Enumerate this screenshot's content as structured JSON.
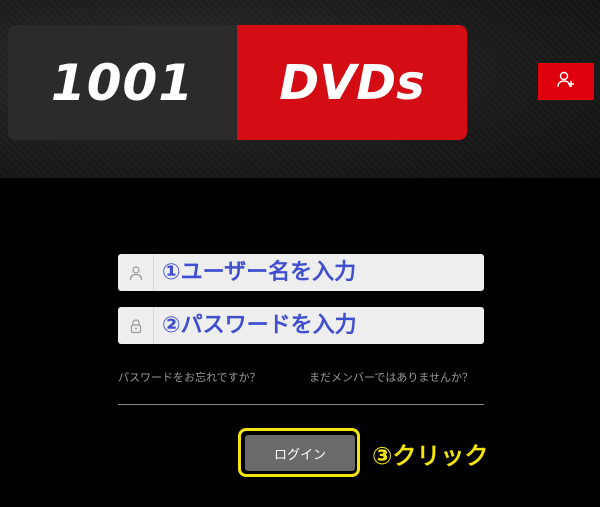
{
  "header": {
    "logo_left": "1001",
    "logo_right": "DVDs",
    "signup_icon": "user-plus-icon"
  },
  "form": {
    "username_placeholder": "①ユーザー名を入力",
    "password_placeholder": "②パスワードを入力",
    "username_icon": "user-icon",
    "password_icon": "lock-icon",
    "forgot_password": "パスワードをお忘れですか？",
    "not_member": "まだメンバーではありませんか？",
    "login_label": "ログイン",
    "step3_label": "③クリック"
  },
  "colors": {
    "brand_red": "#d40c14",
    "annotation_blue": "#3f4fd0",
    "annotation_yellow": "#f2e40c",
    "login_button": "#6a6a6a"
  }
}
